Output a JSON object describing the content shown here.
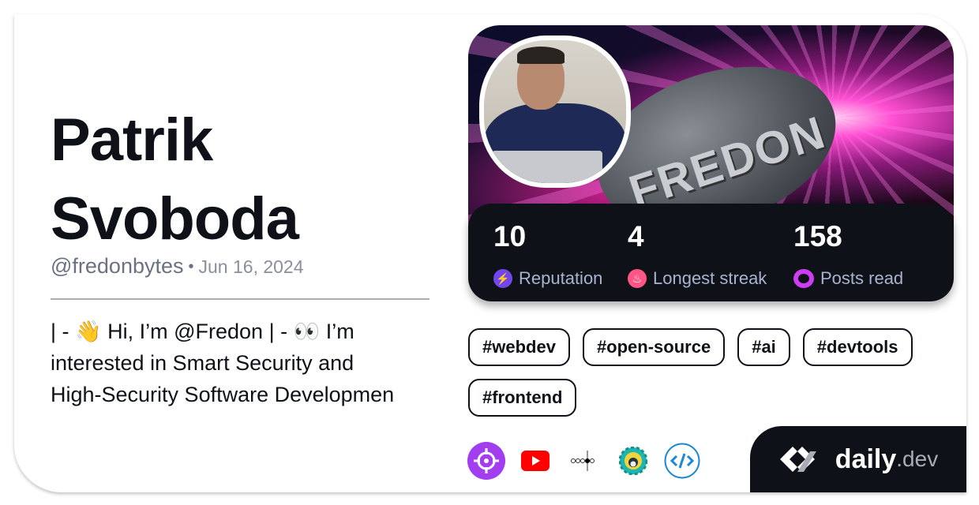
{
  "profile": {
    "name_line1": "Patrik",
    "name_line2": "Svoboda",
    "handle": "@fredonbytes",
    "separator": "•",
    "date": "Jun 16, 2024",
    "bio_lines": [
      "| - 👋 Hi, I’m @Fredon | - 👀 I’m",
      "interested in Smart Security and",
      "High-Security Software Developmen"
    ]
  },
  "cover": {
    "text": "FREDON"
  },
  "stats": [
    {
      "value": "10",
      "label": "Reputation",
      "icon": "lightning-icon",
      "color": "#7147ed"
    },
    {
      "value": "4",
      "label": "Longest streak",
      "icon": "flame-icon",
      "color": "#ff5587"
    },
    {
      "value": "158",
      "label": "Posts read",
      "icon": "eye-ring-icon",
      "color": "#ce3df3"
    }
  ],
  "tags": [
    "#webdev",
    "#open-source",
    "#ai",
    "#devtools",
    "#frontend"
  ],
  "links": [
    "crosshair-icon",
    "youtube-icon",
    "network-icon",
    "gear-avatar-icon",
    "code-icon"
  ],
  "brand": {
    "name": "daily",
    "suffix": ".dev"
  }
}
